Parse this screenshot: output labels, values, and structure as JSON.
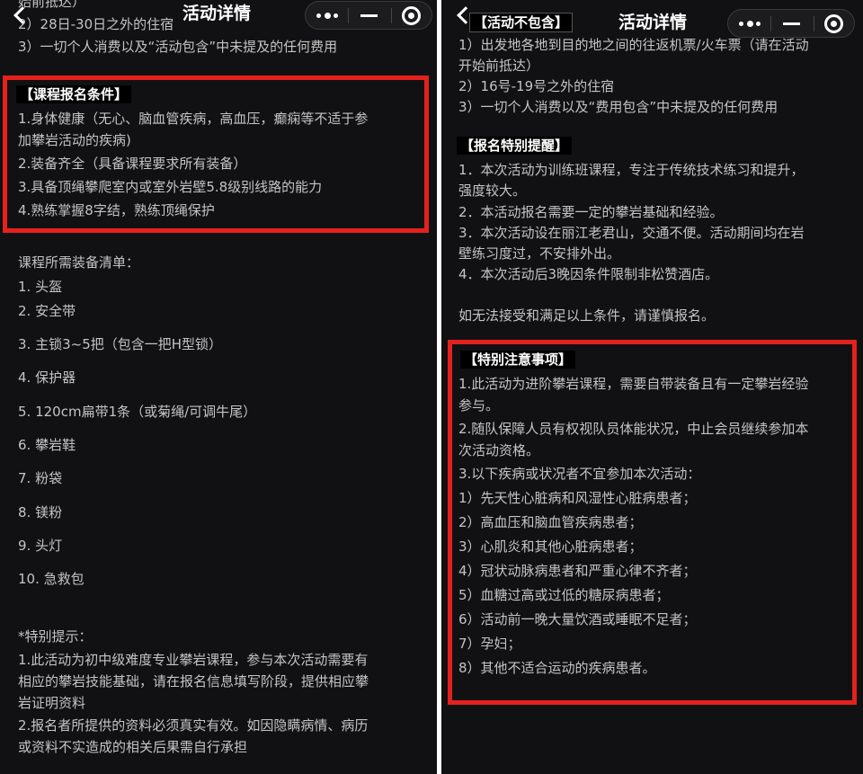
{
  "left": {
    "title": "活动详情",
    "top_lines": [
      "始前抵达）",
      "2）28日-30日之外的住宿",
      "3）一切个人消费以及“活动包含”中未提及的任何费用"
    ],
    "conditions": {
      "heading": "【课程报名条件】",
      "items": [
        "1.身体健康（无心、脑血管疾病，高血压，癫痫等不适于参",
        "加攀岩活动的疾病)",
        "2.装备齐全（具备课程要求所有装备）",
        "3.具备顶绳攀爬室内或室外岩壁5.8级别线路的能力",
        "4.熟练掌握8字结，熟练顶绳保护"
      ]
    },
    "equipment_title": "课程所需装备清单：",
    "equipment": [
      "1. 头盔",
      "2. 安全带",
      "3. 主锁3~5把（包含一把H型锁）",
      "4. 保护器",
      "5. 120cm扁带1条（或菊绳/可调牛尾）",
      "6. 攀岩鞋",
      "7. 粉袋",
      "8. 镁粉",
      "9. 头灯",
      "10. 急救包"
    ],
    "tips_title": "*特别提示：",
    "tips": [
      "1.此活动为初中级难度专业攀岩课程，参与本次活动需要有",
      "相应的攀岩技能基础，请在报名信息填写阶段，提供相应攀",
      "岩证明资料",
      "2.报名者所提供的资料必须真实有效。如因隐瞒病情、病历",
      "或资料不实造成的相关后果需自行承担"
    ]
  },
  "right": {
    "title": "活动详情",
    "excluded_tag": "【活动不包含】",
    "excluded": [
      "1）出发地各地到目的地之间的往返机票/火车票（请在活动",
      "开始前抵达）",
      "2）16号-19号之外的住宿",
      "3）一切个人消费以及“费用包含”中未提及的任何费用"
    ],
    "reminder": {
      "heading": "【报名特别提醒】",
      "items": [
        "1．本次活动为训练班课程，专注于传统技术练习和提升，",
        "强度较大。",
        "2．本活动报名需要一定的攀岩基础和经验。",
        "3．本次活动设在丽江老君山，交通不便。活动期间均在岩",
        "壁练习度过，不安排外出。",
        "4．本次活动后3晚因条件限制非松赞酒店。"
      ]
    },
    "notice": "如无法接受和满足以上条件，请谨慎报名。",
    "attention": {
      "heading": "【特别注意事项】",
      "items": [
        "1.此活动为进阶攀岩课程，需要自带装备且有一定攀岩经验",
        "参与。",
        "2.随队保障人员有权视队员体能状况，中止会员继续参加本",
        "次活动资格。",
        "3.以下疾病或状况者不宜参加本次活动：",
        "1）先天性心脏病和风湿性心脏病患者；",
        "2）高血压和脑血管疾病患者；",
        "3）心肌炎和其他心脏病患者；",
        "4）冠状动脉病患者和严重心律不齐者；",
        "5）血糖过高或过低的糖尿病患者；",
        "6）活动前一晚大量饮酒或睡眠不足者；",
        "7）孕妇；",
        "8）其他不适合运动的疾病患者。"
      ]
    }
  },
  "colors": {
    "highlight": "#e5211d",
    "background": "#111113",
    "text": "#c4c4c4"
  }
}
